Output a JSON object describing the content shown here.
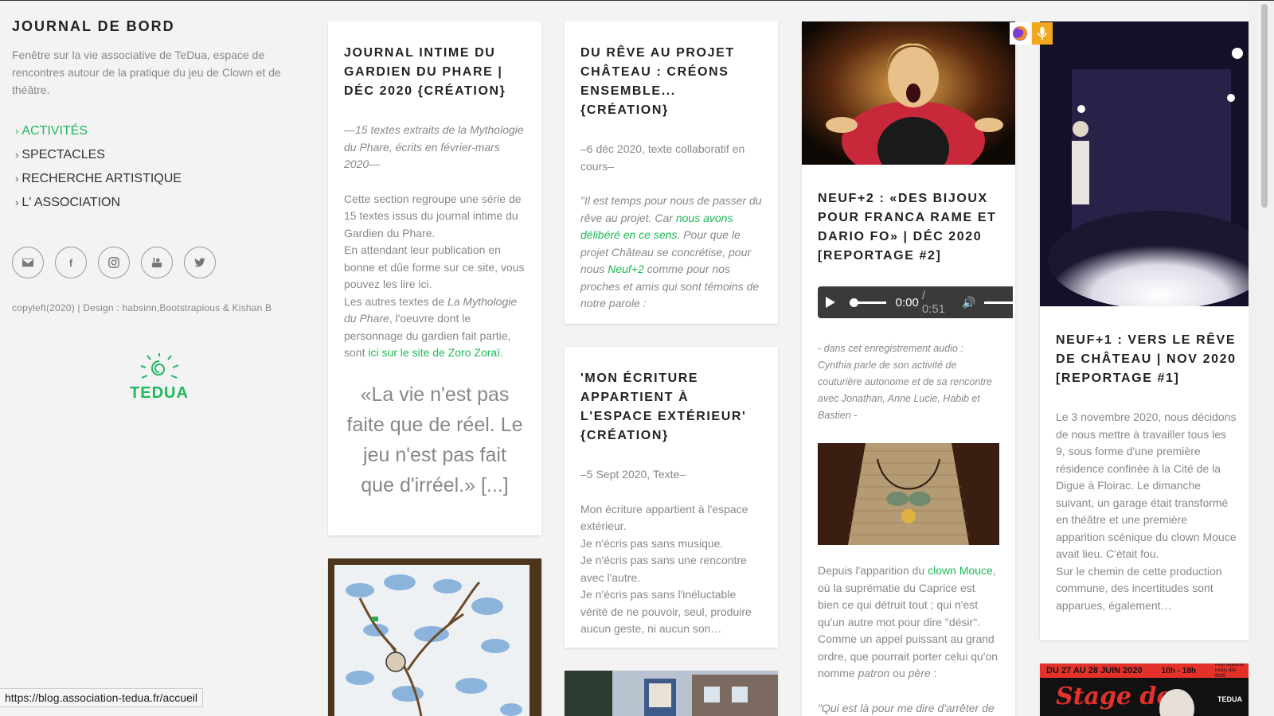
{
  "sidebar": {
    "title": "JOURNAL DE BORD",
    "description": "Fenêtre sur la vie associative de TeDua, espace de rencontres autour de la pratique du jeu de Clown et de théâtre.",
    "menu": [
      "ACTIVITÉS",
      "SPECTACLES",
      "RECHERCHE ARTISTIQUE",
      "L' ASSOCIATION"
    ],
    "copyleft": "copyleft(2020) | Design : habsinn,Bootstrapious & Kishan B",
    "logo_text": "TEDUA",
    "accent": "#1fb85a"
  },
  "cards": {
    "c1": {
      "title": "JOURNAL INTIME DU GARDIEN DU PHARE | DÉC 2020 {CRÉATION}",
      "sub": "—15 textes extraits de la Mythologie du Phare, écrits en février-mars 2020—",
      "p1": "Cette section regroupe une série de 15 textes issus du journal intime du Gardien du Phare.",
      "p2": "En attendant leur publication en bonne et dûe forme sur ce site, vous pouvez les lire ici.",
      "p3a": "Les autres textes de ",
      "p3b": "La Mythologie du Phare",
      "p3c": ", l'oeuvre dont le personnage du gardien fait partie, sont ",
      "p3link": "ici sur le site de Zoro Zoraï",
      "p3d": ".",
      "quote": "«La vie n'est pas faite que de réel. Le jeu n'est pas fait que d'irréel.» [...]"
    },
    "c2": {
      "title": "DU RÊVE AU PROJET CHÂTEAU : CRÉONS ENSEMBLE... {CRÉATION}",
      "sub": "–6 déc 2020, texte collaboratif en cours–",
      "q1": "\"Il est temps pour nous de passer du rêve au projet. Car ",
      "q1link": "nous avons délibéré en ce sens",
      "q2": ". Pour que le projet Château se concrétise, pour nous ",
      "q2link": "Neuf+2",
      "q3": " comme pour nos proches et amis qui sont témoins de notre parole :"
    },
    "c3": {
      "title": "'MON ÉCRITURE APPARTIENT À L'ESPACE EXTÉRIEUR' {CRÉATION}",
      "sub": "–5 Sept 2020, Texte–",
      "lines": [
        "Mon écriture appartient à l'espace extérieur.",
        "Je n'écris pas sans musique.",
        "Je n'écris pas sans une rencontre avec l'autre.",
        "Je n'écris pas sans l'inéluctable vérité de ne pouvoir, seul, produire aucun geste, ni aucun son…"
      ]
    },
    "c4": {
      "title": "NEUF+2 : «DES BIJOUX POUR FRANCA RAME ET DARIO FO» | DÉC 2020 [REPORTAGE #2]",
      "audio_time": "0:00",
      "audio_duration": "/ 0:51",
      "caption": "- dans cet enregistrement audio : Cynthia parle de son activité de couturière autonome et de sa rencontre avec Jonathan, Anne Lucie, Habib et Bastien -",
      "p1a": "Depuis l'apparition du ",
      "p1link": "clown Mouce",
      "p1b": ", où la suprématie du Caprice est bien ce qui détruit tout ; qui n'est qu'un autre mot pour dire \"désir\". Comme un appel puissant au grand ordre, que pourrait porter celui qu'on nomme ",
      "p1c": "patron",
      "p1d": " ou ",
      "p1e": "père",
      "p1f": " :",
      "p2": "\"Qui est là pour me dire d'arrêter de"
    },
    "c5": {
      "title": "NEUF+1 : VERS LE RÊVE DE CHÂTEAU | NOV 2020 [REPORTAGE #1]",
      "p1": "Le 3 novembre 2020, nous décidons de nous mettre à travailler tous les 9, sous forme d'une première résidence confinée à la Cité de la Digue à Floirac. Le dimanche suivant, un garage était transformé en théâtre et une première apparition scénique du clown Mouce avait lieu. C'était fou.",
      "p2": "Sur le chemin de cette production commune, des incertitudes sont apparues, également…"
    },
    "poster": {
      "date": "DU 27 AU 28 JUIN 2020",
      "hours": "10h - 18h",
      "note": "Petit déjeuner inclus dès 9h30",
      "title": "Stage de",
      "logo": "TEDUA"
    }
  },
  "statusbar": "https://blog.association-tedua.fr/accueil"
}
